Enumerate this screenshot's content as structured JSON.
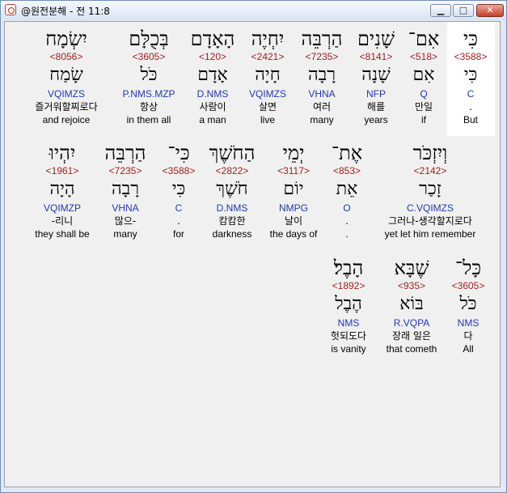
{
  "window": {
    "title": "@원전분해 - 전 11:8"
  },
  "rows": [
    {
      "words": [
        {
          "hebrew": "כִּי",
          "strongs": "<3588>",
          "lemma": "כִּי",
          "parse": "C",
          "korean": ".",
          "english": "But"
        },
        {
          "hebrew": "אִם־",
          "strongs": "<518>",
          "lemma": "אִם",
          "parse": "Q",
          "korean": "만일",
          "english": "if"
        },
        {
          "hebrew": "שָׁנִים",
          "strongs": "<8141>",
          "lemma": "שָׁנָה",
          "parse": "NFP",
          "korean": "해를",
          "english": "years"
        },
        {
          "hebrew": "הַרְבֵּה",
          "strongs": "<7235>",
          "lemma": "רָבָה",
          "parse": "VHNA",
          "korean": "여러",
          "english": "many"
        },
        {
          "hebrew": "יִחְיֶה",
          "strongs": "<2421>",
          "lemma": "חָיָה",
          "parse": "VQIMZS",
          "korean": "살면",
          "english": "live"
        },
        {
          "hebrew": "הָאָדָם",
          "strongs": "<120>",
          "lemma": "אָדָם",
          "parse": "D.NMS",
          "korean": "사람이",
          "english": "a man"
        },
        {
          "hebrew": "בְּכֻלָּם",
          "strongs": "<3605>",
          "lemma": "כֹּל",
          "parse": "P.NMS.MZP",
          "korean": "항상",
          "english": "in them all"
        },
        {
          "hebrew": "יִשְׂמָח",
          "strongs": "<8056>",
          "lemma": "שָׂמַח",
          "parse": "VQIMZS",
          "korean": "즐거워할찌로다",
          "english": "and rejoice"
        }
      ]
    },
    {
      "words": [
        {
          "hebrew": "וְיִזְכֹּר",
          "strongs": "<2142>",
          "lemma": "זָכַר",
          "parse": "C.VQIMZS",
          "korean": "그러나-생각할지로다",
          "english": "yet let him remember"
        },
        {
          "hebrew": "אֶת־",
          "strongs": "<853>",
          "lemma": "אֵת",
          "parse": "O",
          "korean": ".",
          "english": "."
        },
        {
          "hebrew": "יְמֵי",
          "strongs": "<3117>",
          "lemma": "יוֹם",
          "parse": "NMPG",
          "korean": "날이",
          "english": "the days of"
        },
        {
          "hebrew": "הַחֹשֶׁךְ",
          "strongs": "<2822>",
          "lemma": "חֹשֶׁךְ",
          "parse": "D.NMS",
          "korean": "캄캄한",
          "english": "darkness"
        },
        {
          "hebrew": "כִּי־",
          "strongs": "<3588>",
          "lemma": "כִּי",
          "parse": "C",
          "korean": ".",
          "english": "for"
        },
        {
          "hebrew": "הַרְבֵּה",
          "strongs": "<7235>",
          "lemma": "רָבָה",
          "parse": "VHNA",
          "korean": "많으-",
          "english": "many"
        },
        {
          "hebrew": "יִהְיוּ",
          "strongs": "<1961>",
          "lemma": "הָיָה",
          "parse": "VQIMZP",
          "korean": "-리니",
          "english": "they shall be"
        }
      ]
    },
    {
      "words": [
        {
          "hebrew": "כָּל־",
          "strongs": "<3605>",
          "lemma": "כֹּל",
          "parse": "NMS",
          "korean": "다",
          "english": "All"
        },
        {
          "hebrew": "שֶׁבָּא",
          "strongs": "<935>",
          "lemma": "בּוֹא",
          "parse": "R.VQPA",
          "korean": "장래 일은",
          "english": "that cometh"
        },
        {
          "hebrew": "הָבֶל׃",
          "strongs": "<1892>",
          "lemma": "הֶבֶל",
          "parse": "NMS",
          "korean": "헛되도다",
          "english": "is vanity"
        }
      ]
    }
  ]
}
